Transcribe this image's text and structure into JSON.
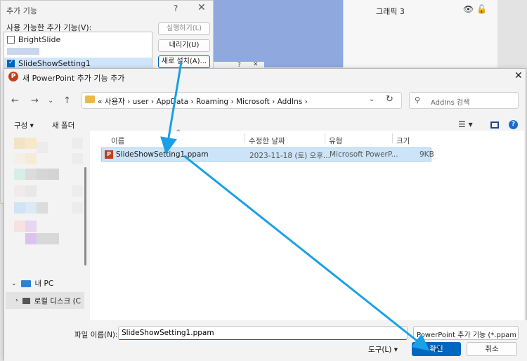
{
  "background": {
    "layers": [
      {
        "label": "그래픽 3"
      }
    ],
    "layer_icons": "eye-icon lock-icon"
  },
  "addins_dialog": {
    "title": "추가 기능",
    "help": "?",
    "close": "✕",
    "available_label": "사용 가능한 추가 기능(V):",
    "items": [
      {
        "label": "BrightSlide",
        "checked": false
      },
      {
        "label": "SlideShowSetting1",
        "checked": true
      }
    ],
    "buttons": {
      "run": "실행하기(L)",
      "unload": "내리기(U)",
      "add_new": "새로 설치(A)..."
    },
    "mini_title": "?"
  },
  "file_dialog": {
    "title": "새 PowerPoint 추가 기능 추가",
    "close": "✕",
    "address": {
      "prefix": "«",
      "segments": [
        "사용자",
        "user",
        "AppData",
        "Roaming",
        "Microsoft",
        "AddIns"
      ],
      "separator": "›"
    },
    "search_placeholder": "AddIns 검색",
    "commands": {
      "organize": "구성 ▾",
      "new_folder": "새 폴더"
    },
    "nav": {
      "this_pc": "내 PC",
      "local_disk": "로컬 디스크 (C"
    },
    "columns": [
      "이름",
      "수정한 날짜",
      "유형",
      "크기"
    ],
    "files": [
      {
        "name": "SlideShowSetting1.ppam",
        "modified": "2023-11-18 (토) 오후...",
        "type": "Microsoft PowerP...",
        "size": "9KB"
      }
    ],
    "filename_label": "파일 이름(N):",
    "filename_value": "SlideShowSetting1.ppam",
    "file_type": "PowerPoint 추가 기능 (*.ppam",
    "tools": "도구(L)",
    "ok": "확인",
    "cancel": "취소"
  },
  "colors": {
    "accent": "#0067c0",
    "arrow": "#1aa0e6",
    "selection": "#cce4f7"
  }
}
